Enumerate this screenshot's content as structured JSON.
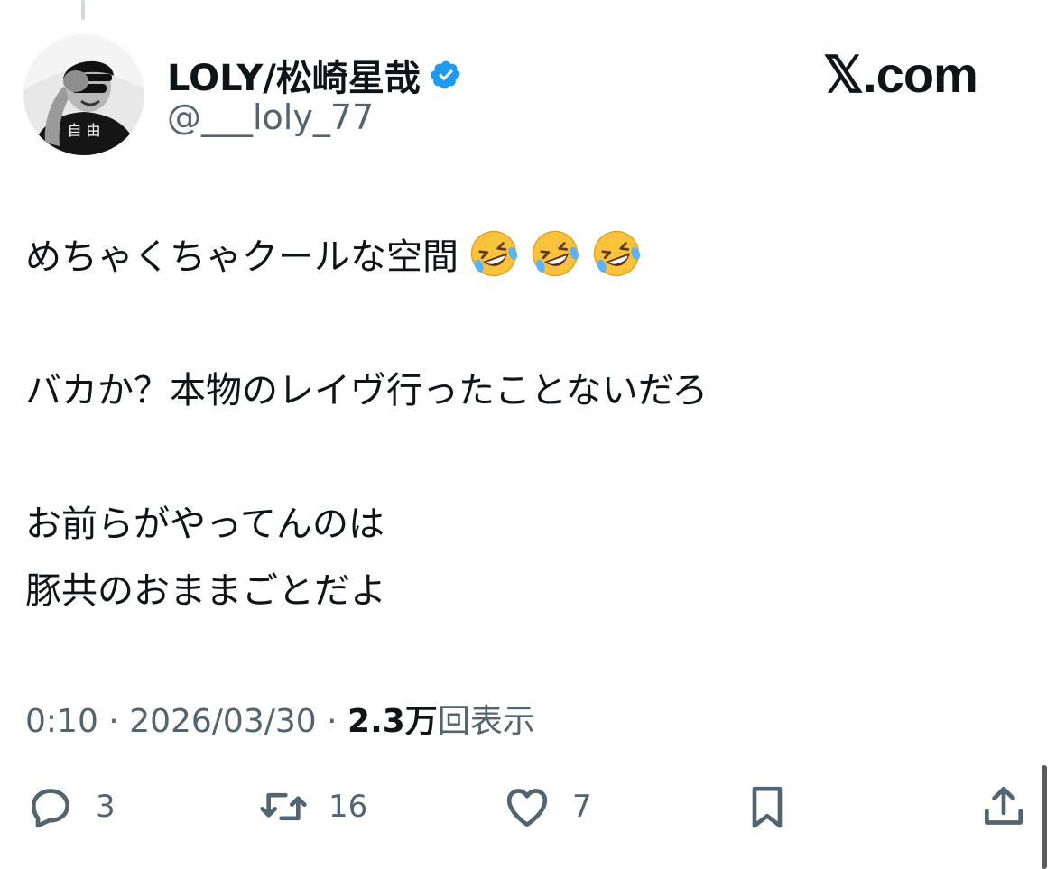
{
  "author": {
    "display_name": "LOLY/松崎星哉",
    "handle": "@___loly_77",
    "verified_icon": "verified-badge-icon",
    "avatar_shirt_text": "自 由"
  },
  "branding": {
    "logo_text": "𝕏.com"
  },
  "tweet": {
    "lines": [
      "めちゃくちゃクールな空間",
      "バカか？本物のレイヴ行ったことないだろ",
      "お前らがやってんのは",
      "豚共のおままごとだよ"
    ],
    "emoji_name": "rolling-on-the-floor-laughing",
    "emoji_count": 3
  },
  "meta": {
    "time": "0:10",
    "date": "2026/03/30",
    "views_number": "2.3万",
    "views_label": "回表示"
  },
  "actions": {
    "reply_count": "3",
    "retweet_count": "16",
    "like_count": "7"
  },
  "colors": {
    "text": "#0f1419",
    "secondary": "#536471",
    "verified": "#1d9bf0"
  }
}
